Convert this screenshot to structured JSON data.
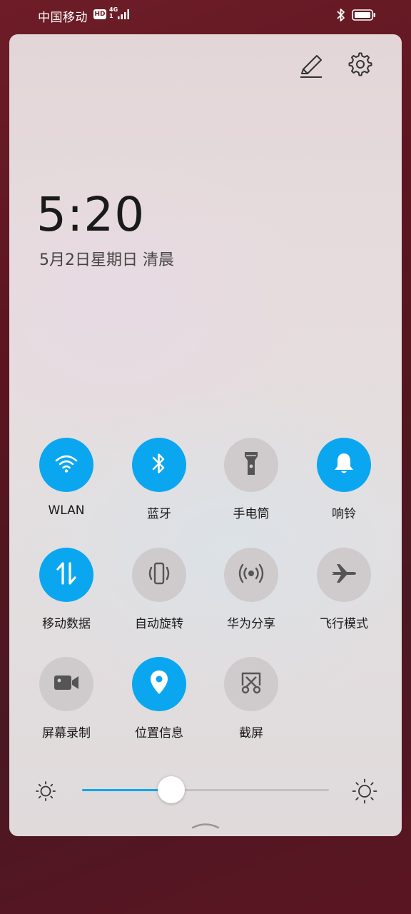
{
  "status_bar": {
    "carrier": "中国移动",
    "hd_label": "HD",
    "network_type": "4G",
    "network_sub": "1",
    "icons": [
      "signal-icon",
      "bluetooth-icon",
      "battery-icon"
    ]
  },
  "panel": {
    "time": "5:20",
    "date": "5月2日星期日 清晨",
    "toolbar_icons": [
      "edit-icon",
      "settings-icon"
    ]
  },
  "tiles": [
    {
      "label": "WLAN",
      "icon": "wifi-icon",
      "active": true
    },
    {
      "label": "蓝牙",
      "icon": "bluetooth-icon",
      "active": true
    },
    {
      "label": "手电筒",
      "icon": "flashlight-icon",
      "active": false
    },
    {
      "label": "响铃",
      "icon": "bell-icon",
      "active": true
    },
    {
      "label": "移动数据",
      "icon": "mobile-data-icon",
      "active": true
    },
    {
      "label": "自动旋转",
      "icon": "auto-rotate-icon",
      "active": false
    },
    {
      "label": "华为分享",
      "icon": "huawei-share-icon",
      "active": false
    },
    {
      "label": "飞行模式",
      "icon": "airplane-icon",
      "active": false
    },
    {
      "label": "屏幕录制",
      "icon": "screen-record-icon",
      "active": false
    },
    {
      "label": "位置信息",
      "icon": "location-icon",
      "active": true
    },
    {
      "label": "截屏",
      "icon": "screenshot-icon",
      "active": false
    }
  ],
  "brightness": {
    "level": 0.36,
    "icons": [
      "brightness-low-icon",
      "brightness-high-icon"
    ]
  },
  "colors": {
    "accent": "#0aa7f0",
    "tile_off": "#cfcacb",
    "wallpaper": "#6e1d27"
  }
}
